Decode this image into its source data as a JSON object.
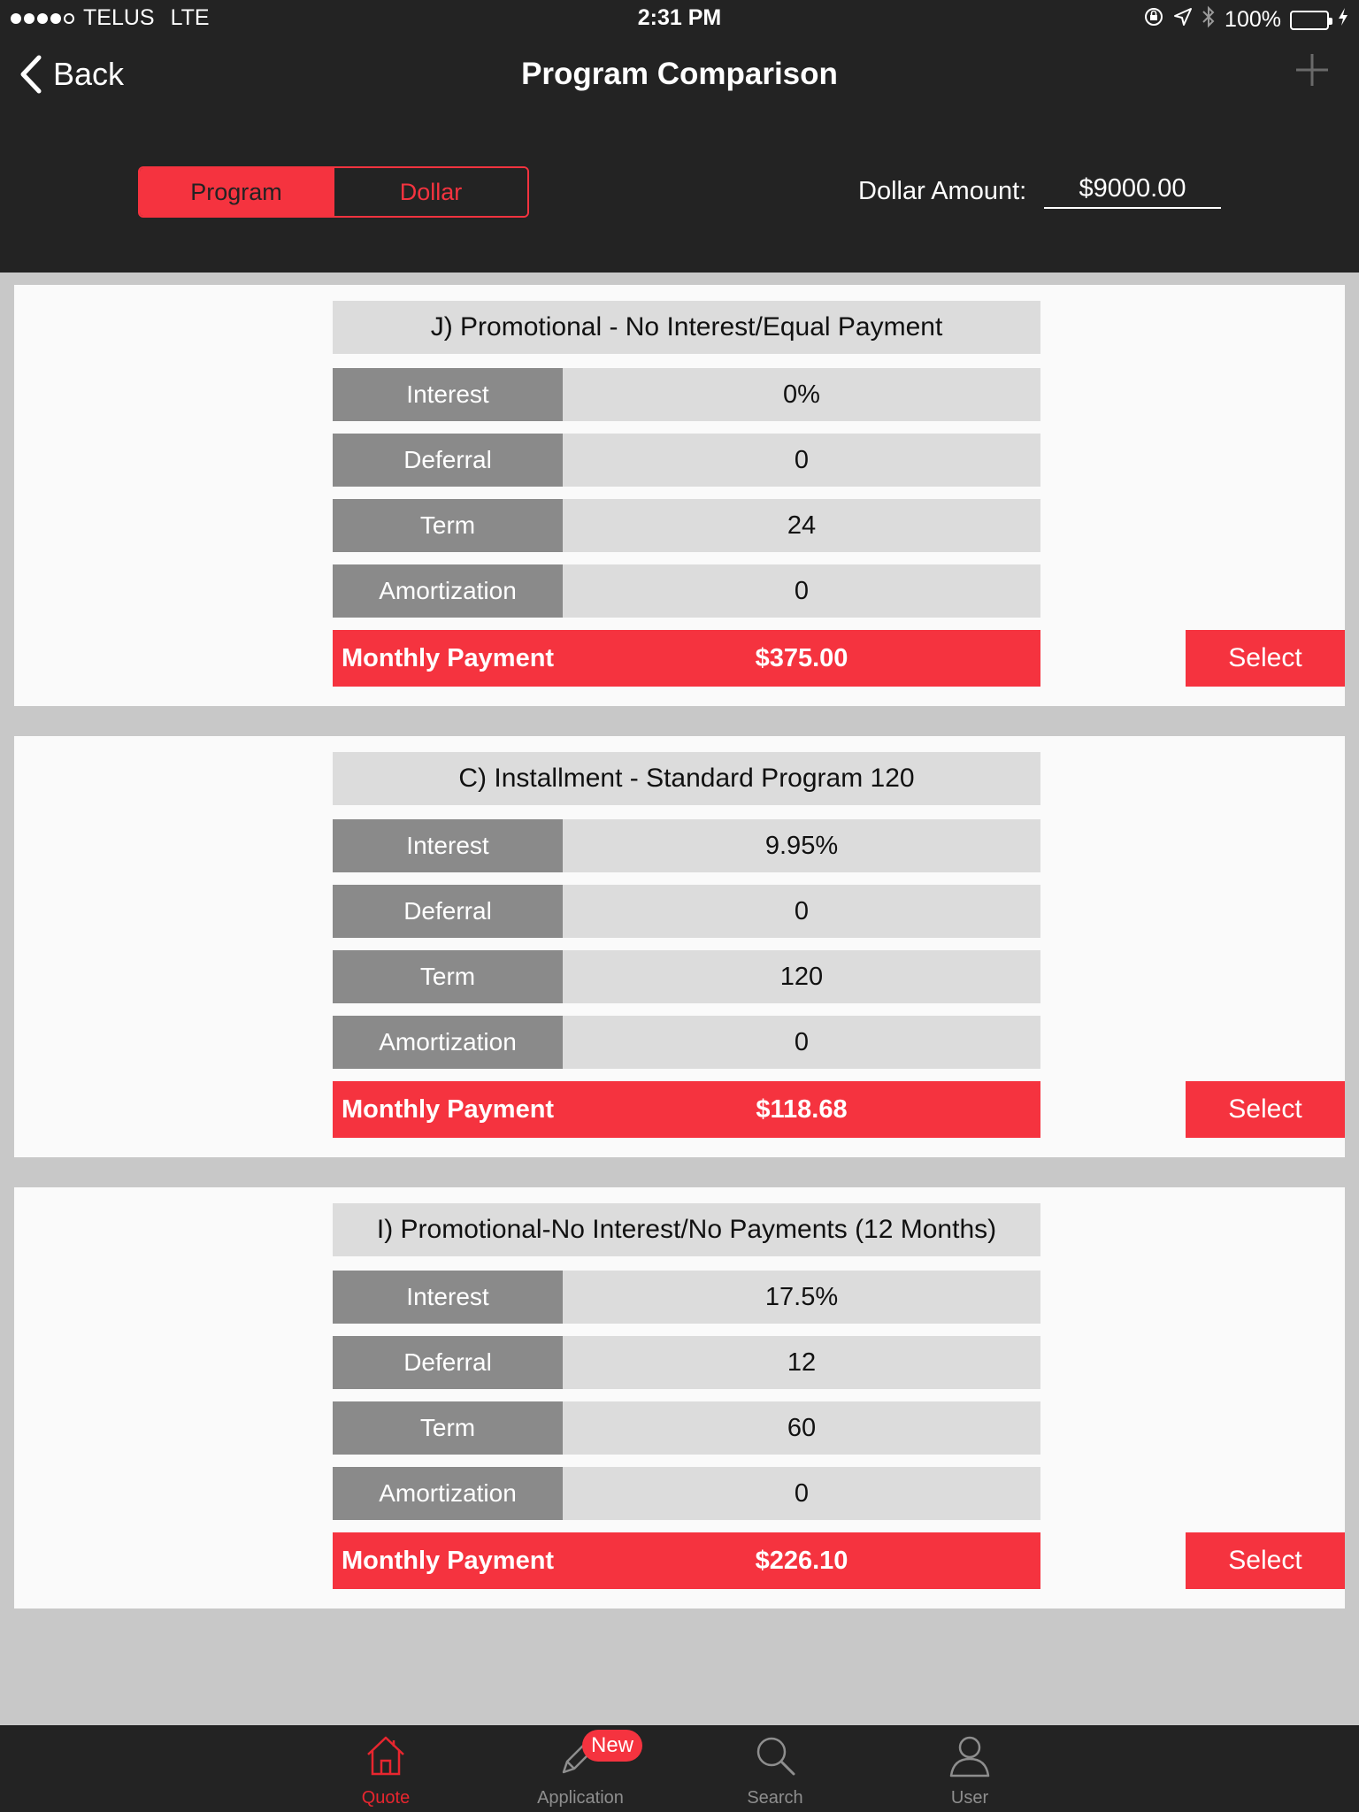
{
  "status_bar": {
    "carrier": "TELUS",
    "network": "LTE",
    "time": "2:31 PM",
    "battery": "100%",
    "icons": [
      "orientation-lock-icon",
      "location-icon",
      "bluetooth-icon",
      "battery-icon"
    ]
  },
  "nav": {
    "back_label": "Back",
    "title": "Program Comparison",
    "add_icon": "plus-icon"
  },
  "controls": {
    "segments": [
      {
        "label": "Program",
        "active": true
      },
      {
        "label": "Dollar",
        "active": false
      }
    ],
    "amount_label": "Dollar Amount:",
    "amount_value": "$9000.00"
  },
  "programs": [
    {
      "title": "J) Promotional - No Interest/Equal Payment",
      "rows": [
        {
          "label": "Interest",
          "value": "0%"
        },
        {
          "label": "Deferral",
          "value": "0"
        },
        {
          "label": "Term",
          "value": "24"
        },
        {
          "label": "Amortization",
          "value": "0"
        }
      ],
      "payment_label": "Monthly Payment",
      "payment_value": "$375.00",
      "select_label": "Select"
    },
    {
      "title": "C) Installment - Standard Program 120",
      "rows": [
        {
          "label": "Interest",
          "value": "9.95%"
        },
        {
          "label": "Deferral",
          "value": "0"
        },
        {
          "label": "Term",
          "value": "120"
        },
        {
          "label": "Amortization",
          "value": "0"
        }
      ],
      "payment_label": "Monthly Payment",
      "payment_value": "$118.68",
      "select_label": "Select"
    },
    {
      "title": "I) Promotional-No Interest/No Payments (12 Months)",
      "rows": [
        {
          "label": "Interest",
          "value": "17.5%"
        },
        {
          "label": "Deferral",
          "value": "12"
        },
        {
          "label": "Term",
          "value": "60"
        },
        {
          "label": "Amortization",
          "value": "0"
        }
      ],
      "payment_label": "Monthly Payment",
      "payment_value": "$226.10",
      "select_label": "Select"
    }
  ],
  "tab_bar": {
    "tabs": [
      {
        "label": "Quote",
        "icon": "home-icon",
        "active": true
      },
      {
        "label": "Application",
        "icon": "pencil-icon",
        "active": false,
        "badge": "New"
      },
      {
        "label": "Search",
        "icon": "search-icon",
        "active": false
      },
      {
        "label": "User",
        "icon": "user-icon",
        "active": false
      }
    ]
  },
  "colors": {
    "accent": "#f5333f",
    "dark_bar": "#232323",
    "label_cell": "#8a8a8a",
    "value_cell": "#dcdcdc",
    "background": "#c8c8c8"
  }
}
